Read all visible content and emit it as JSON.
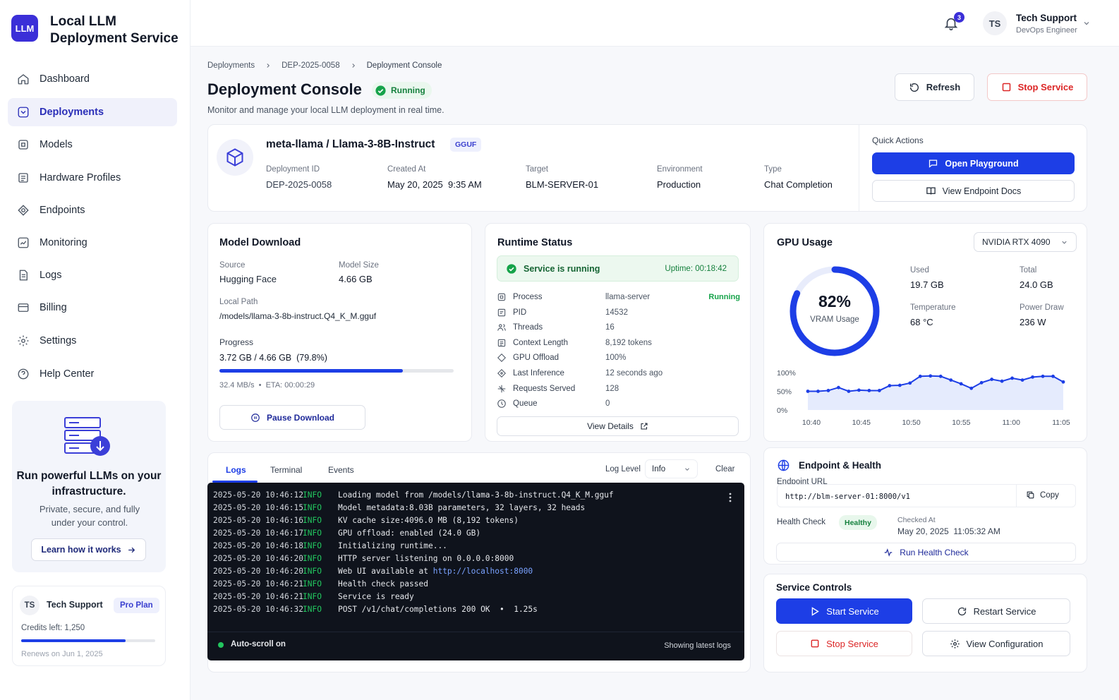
{
  "app": {
    "logo": "LLM",
    "title_line1": "Local LLM",
    "title_line2": "Deployment Service"
  },
  "nav": [
    {
      "label": "Dashboard",
      "icon": "home-icon"
    },
    {
      "label": "Deployments",
      "icon": "deploy-icon",
      "active": true
    },
    {
      "label": "Models",
      "icon": "cube-icon"
    },
    {
      "label": "Hardware Profiles",
      "icon": "chip-icon"
    },
    {
      "label": "Endpoints",
      "icon": "endpoint-icon"
    },
    {
      "label": "Monitoring",
      "icon": "chart-icon"
    },
    {
      "label": "Logs",
      "icon": "document-icon"
    },
    {
      "label": "Billing",
      "icon": "card-icon"
    },
    {
      "label": "Settings",
      "icon": "gear-icon"
    },
    {
      "label": "Help Center",
      "icon": "help-icon"
    }
  ],
  "promo": {
    "title": "Run powerful LLMs on your infrastructure.",
    "subtitle": "Private, secure, and fully under your control.",
    "button": "Learn how it works"
  },
  "plan": {
    "initials": "TS",
    "name": "Tech Support",
    "plan": "Pro Plan",
    "credits": "Credits left: 1,250",
    "credits_fraction": 0.78,
    "renews": "Renews on Jun 1, 2025"
  },
  "topbar": {
    "notification_count": "3",
    "user_initials": "TS",
    "user_name": "Tech Support",
    "user_role": "DevOps Engineer"
  },
  "breadcrumb": [
    "Deployments",
    "DEP-2025-0058",
    "Deployment Console"
  ],
  "page": {
    "title": "Deployment Console",
    "status": "Running",
    "subtitle": "Monitor and manage your local LLM deployment in real time.",
    "refresh": "Refresh",
    "stop": "Stop Service"
  },
  "model": {
    "name": "meta-llama / Llama-3-8B-Instruct",
    "format": "GGUF",
    "fields": [
      {
        "label": "Deployment ID",
        "value": "DEP-2025-0058"
      },
      {
        "label": "Created At",
        "value": "May 20, 2025  9:35 AM"
      },
      {
        "label": "Target",
        "value": "BLM-SERVER-01"
      },
      {
        "label": "Environment",
        "value": "Production"
      },
      {
        "label": "Type",
        "value": "Chat Completion"
      }
    ]
  },
  "quick_actions": {
    "title": "Quick Actions",
    "playground": "Open Playground",
    "docs": "View Endpoint Docs"
  },
  "download": {
    "title": "Model Download",
    "source_label": "Source",
    "source": "Hugging Face",
    "size_label": "Model Size",
    "size": "4.66 GB",
    "path_label": "Local Path",
    "path": "/models/llama-3-8b-instruct.Q4_K_M.gguf",
    "progress_label": "Progress",
    "progress_text": "3.72 GB / 4.66 GB  (79.8%)",
    "progress": 0.798,
    "speed": "32.4 MB/s  •  ETA: 00:00:29",
    "pause": "Pause Download"
  },
  "runtime": {
    "title": "Runtime Status",
    "banner": "Service is running",
    "uptime": "Uptime: 00:18:42",
    "rows": [
      {
        "key": "Process",
        "value": "llama-server",
        "extra": "Running",
        "icon": "process-icon"
      },
      {
        "key": "PID",
        "value": "14532",
        "icon": "pid-icon"
      },
      {
        "key": "Threads",
        "value": "16",
        "icon": "threads-icon"
      },
      {
        "key": "Context Length",
        "value": "8,192 tokens",
        "icon": "context-icon"
      },
      {
        "key": "GPU Offload",
        "value": "100%",
        "icon": "gpu-icon"
      },
      {
        "key": "Last Inference",
        "value": "12 seconds ago",
        "icon": "inference-icon"
      },
      {
        "key": "Requests Served",
        "value": "128",
        "icon": "requests-icon"
      },
      {
        "key": "Queue",
        "value": "0",
        "icon": "queue-icon"
      }
    ],
    "details": "View Details"
  },
  "gpu": {
    "title": "GPU Usage",
    "device": "NVIDIA RTX 4090",
    "vram_pct": "82%",
    "vram_label": "VRAM Usage",
    "vram_fraction": 0.82,
    "stats": [
      {
        "label": "Used",
        "value": "19.7 GB"
      },
      {
        "label": "Total",
        "value": "24.0 GB"
      },
      {
        "label": "Temperature",
        "value": "68 °C"
      },
      {
        "label": "Power Draw",
        "value": "236 W"
      }
    ]
  },
  "chart_data": {
    "type": "area",
    "title": "",
    "xlabel": "",
    "ylabel": "",
    "x_ticks": [
      "10:40",
      "10:45",
      "10:50",
      "10:55",
      "11:00",
      "11:05"
    ],
    "y_ticks": [
      "100%",
      "50%",
      "0%"
    ],
    "ylim": [
      0,
      100
    ],
    "x_minutes": [
      0,
      1,
      2,
      3,
      4,
      5,
      6,
      7,
      8,
      9,
      10,
      11,
      12,
      13,
      14,
      15,
      16,
      17,
      18,
      19,
      20,
      21,
      22,
      23,
      24,
      25
    ],
    "values": [
      50,
      50,
      52,
      60,
      50,
      53,
      52,
      52,
      65,
      66,
      72,
      90,
      91,
      90,
      80,
      70,
      58,
      73,
      82,
      77,
      85,
      80,
      88,
      90,
      90,
      75
    ],
    "grid": false
  },
  "logs": {
    "tabs": [
      "Logs",
      "Terminal",
      "Events"
    ],
    "level_label": "Log Level",
    "level": "Info",
    "clear": "Clear",
    "lines": [
      {
        "time": "2025-05-20 10:46:12",
        "level": "INFO",
        "msg": "Loading model from /models/llama-3-8b-instruct.Q4_K_M.gguf"
      },
      {
        "time": "2025-05-20 10:46:15",
        "level": "INFO",
        "msg": "Model metadata:8.03B parameters, 32 layers, 32 heads"
      },
      {
        "time": "2025-05-20 10:46:16",
        "level": "INFO",
        "msg": "KV cache size:4096.0 MB (8,192 tokens)"
      },
      {
        "time": "2025-05-20 10:46:17",
        "level": "INFO",
        "msg": "GPU offload: enabled (24.0 GB)"
      },
      {
        "time": "2025-05-20 10:46:18",
        "level": "INFO",
        "msg": "Initializing runtime..."
      },
      {
        "time": "2025-05-20 10:46:20",
        "level": "INFO",
        "msg": "HTTP server listening on 0.0.0.0:8000"
      },
      {
        "time": "2025-05-20 10:46:20",
        "level": "INFO",
        "msg": "Web UI available at ",
        "link": "http://localhost:8000"
      },
      {
        "time": "2025-05-20 10:46:21",
        "level": "INFO",
        "msg": "Health check passed"
      },
      {
        "time": "2025-05-20 10:46:21",
        "level": "INFO",
        "msg": "Service is ready"
      },
      {
        "time": "2025-05-20 10:46:32",
        "level": "INFO",
        "msg": "POST /v1/chat/completions 200 OK  •  1.25s"
      }
    ],
    "autoscroll": "Auto-scroll on",
    "showing": "Showing latest logs"
  },
  "endpoint": {
    "title": "Endpoint & Health",
    "url_label": "Endpoint URL",
    "url": "http://blm-server-01:8000/v1",
    "copy": "Copy",
    "health_label": "Health Check",
    "health": "Healthy",
    "checked_label": "Checked At",
    "checked": "May 20, 2025  11:05:32 AM",
    "run": "Run Health Check"
  },
  "controls": {
    "title": "Service Controls",
    "start": "Start Service",
    "restart": "Restart Service",
    "stop": "Stop Service",
    "config": "View Configuration"
  },
  "colors": {
    "accent": "#1d3ee6",
    "success": "#16a34a",
    "danger": "#dc2626",
    "logo": "#3b2fd8"
  }
}
